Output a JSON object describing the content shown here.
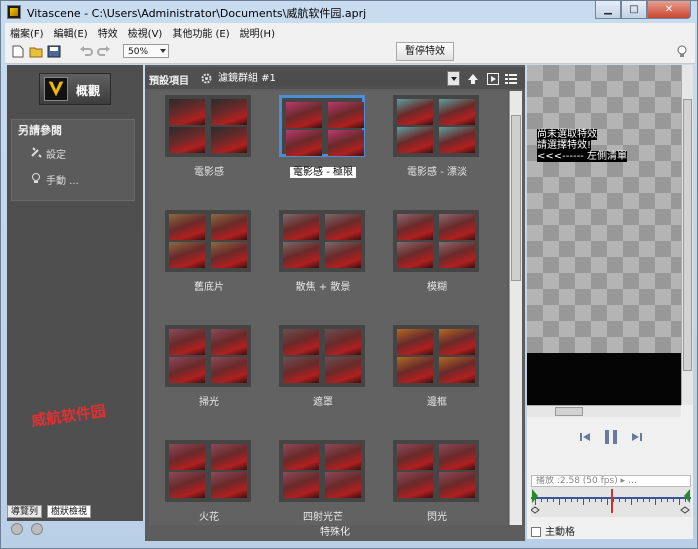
{
  "window": {
    "title": "Vitascene - C:\\Users\\Administrator\\Documents\\威航软件园.aprj",
    "buttons": {
      "minimize": "▁",
      "maximize": "□",
      "close": "✕"
    }
  },
  "menu": [
    "檔案(F)",
    "編輯(E)",
    "特效",
    "檢視(V)",
    "其他功能 (E)",
    "說明(H)"
  ],
  "toolbar": {
    "zoom": "50%",
    "pause_label": "暫停特效"
  },
  "left": {
    "overview_label": "概觀",
    "ref_title": "另請參閱",
    "settings_label": "設定",
    "manual_label": "手動 ...",
    "watermark": "威航软件园",
    "tabs": [
      "導覽列",
      "樹狀檢視"
    ]
  },
  "center": {
    "preset_label": "預設項目",
    "filter_group": "濾鏡群組  #1",
    "footer": "特殊化",
    "effects": [
      {
        "label": "電影感",
        "tint": "#2c2c2c",
        "selected": false
      },
      {
        "label": "電影感 - 極限",
        "tint": "#b83a70",
        "selected": true
      },
      {
        "label": "電影感 - 漂淡",
        "tint": "#5aa0a0",
        "selected": false
      },
      {
        "label": "舊底片",
        "tint": "#8a6a40",
        "selected": false
      },
      {
        "label": "散焦 + 散景",
        "tint": "#7a6a6a",
        "selected": false
      },
      {
        "label": "模糊",
        "tint": "#8a6a70",
        "selected": false
      },
      {
        "label": "掃光",
        "tint": "#8a4a5a",
        "selected": false
      },
      {
        "label": "遮罩",
        "tint": "#6a5050",
        "selected": false
      },
      {
        "label": "邊框",
        "tint": "#b06a20",
        "selected": false
      },
      {
        "label": "火花",
        "tint": "#8a4a5a",
        "selected": false
      },
      {
        "label": "四射光芒",
        "tint": "#8a4a5a",
        "selected": false
      },
      {
        "label": "閃光",
        "tint": "#8a4a5a",
        "selected": false
      }
    ]
  },
  "right": {
    "messages": [
      "尚未選取特效",
      "請選擇特效!",
      "<<<------ 左側清單"
    ],
    "timecode": "播放 :2.58 (50    fps) ▸  …",
    "main_track_label": "主動格"
  },
  "colors": {
    "selection": "#4a8fd6",
    "playhead": "#d03030"
  }
}
